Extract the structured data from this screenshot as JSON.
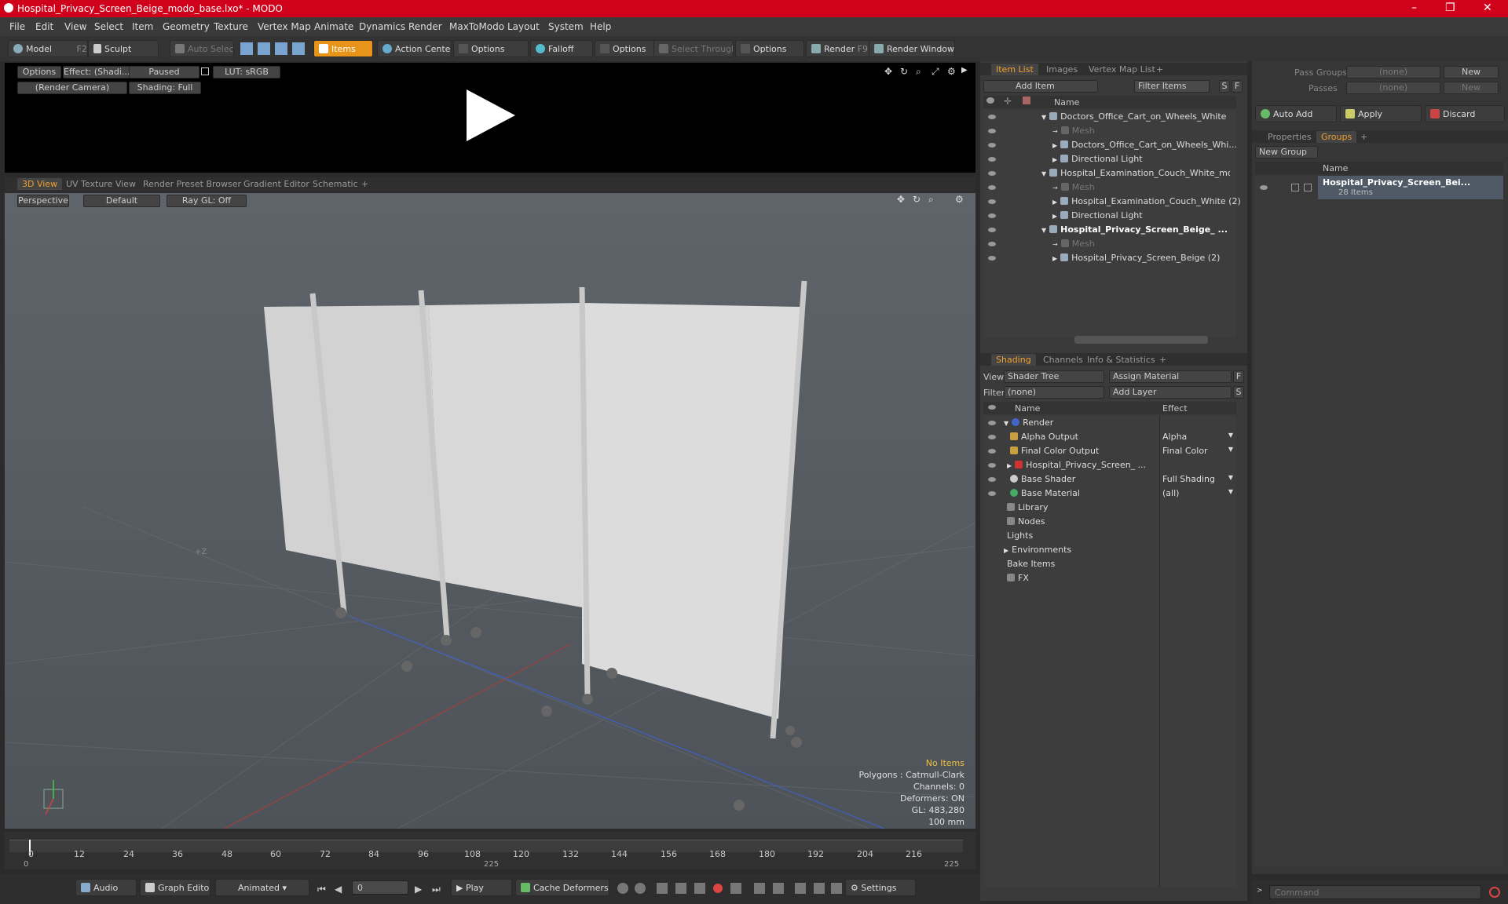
{
  "window": {
    "title": "Hospital_Privacy_Screen_Beige_modo_base.lxo* - MODO",
    "minimize": "–",
    "maximize": "❐",
    "close": "✕"
  },
  "menu": [
    "File",
    "Edit",
    "View",
    "Select",
    "Item",
    "Geometry",
    "Texture",
    "Vertex Map",
    "Animate",
    "Dynamics",
    "Render",
    "MaxToModo",
    "Layout",
    "System",
    "Help"
  ],
  "toolbar": {
    "model": "Model",
    "model_key": "F2",
    "sculpt": "Sculpt",
    "auto_select": "Auto Select",
    "items": "Items",
    "action_center": "Action Center",
    "options1": "Options",
    "falloff": "Falloff",
    "options2": "Options",
    "select_through": "Select Through",
    "options3": "Options",
    "render": "Render",
    "render_key": "F9",
    "render_window": "Render Window"
  },
  "preview": {
    "options": "Options",
    "effect": "Effect: (Shadi...",
    "paused": "Paused",
    "lut": "LUT: sRGB",
    "camera": "(Render Camera)",
    "shading": "Shading: Full"
  },
  "viewport_tabs": [
    "3D View",
    "UV Texture View",
    "Render Preset Browser",
    "Gradient Editor",
    "Schematic",
    "+"
  ],
  "viewport": {
    "perspective": "Perspective",
    "default": "Default",
    "raygl": "Ray GL: Off",
    "axis_label": "+Z",
    "hud": [
      "No Items",
      "Polygons : Catmull-Clark",
      "Channels: 0",
      "Deformers: ON",
      "GL: 483,280",
      "100 mm"
    ]
  },
  "timeline": {
    "ticks": [
      "0",
      "12",
      "24",
      "36",
      "48",
      "60",
      "72",
      "84",
      "96",
      "108",
      "120",
      "132",
      "144",
      "156",
      "168",
      "180",
      "192",
      "204",
      "216"
    ],
    "start": "0",
    "mid": "225",
    "end": "225"
  },
  "bottom": {
    "audio": "Audio",
    "graph_editor": "Graph Editor",
    "animated": "Animated",
    "frame": "0",
    "play": "Play",
    "cache": "Cache Deformers",
    "settings": "Settings"
  },
  "item_list": {
    "tabs": [
      "Item List",
      "Images",
      "Vertex Map List",
      "+"
    ],
    "add_item": "Add Item",
    "filter": "Filter Items",
    "s": "S",
    "f": "F",
    "col_name": "Name",
    "rows": [
      {
        "label": "Doctors_Office_Cart_on_Wheels_White ...",
        "indent": 0,
        "bold": false,
        "dim": false
      },
      {
        "label": "Mesh",
        "indent": 1,
        "bold": false,
        "dim": true
      },
      {
        "label": "Doctors_Office_Cart_on_Wheels_Whi...",
        "indent": 1,
        "bold": false,
        "dim": false
      },
      {
        "label": "Directional Light",
        "indent": 1,
        "bold": false,
        "dim": false
      },
      {
        "label": "Hospital_Examination_Couch_White_mo ...",
        "indent": 0,
        "bold": false,
        "dim": false
      },
      {
        "label": "Mesh",
        "indent": 1,
        "bold": false,
        "dim": true
      },
      {
        "label": "Hospital_Examination_Couch_White (2)",
        "indent": 1,
        "bold": false,
        "dim": false
      },
      {
        "label": "Directional Light",
        "indent": 1,
        "bold": false,
        "dim": false
      },
      {
        "label": "Hospital_Privacy_Screen_Beige_ ...",
        "indent": 0,
        "bold": true,
        "dim": false
      },
      {
        "label": "Mesh",
        "indent": 1,
        "bold": false,
        "dim": true
      },
      {
        "label": "Hospital_Privacy_Screen_Beige (2)",
        "indent": 1,
        "bold": false,
        "dim": false
      }
    ]
  },
  "shading": {
    "tabs": [
      "Shading",
      "Channels",
      "Info & Statistics",
      "+"
    ],
    "view_label": "View",
    "view_value": "Shader Tree",
    "assign": "Assign Material",
    "filter_label": "Filter",
    "filter_value": "(none)",
    "add_layer": "Add Layer",
    "f": "F",
    "s": "S",
    "col_name": "Name",
    "col_effect": "Effect",
    "rows": [
      {
        "label": "Render",
        "effect": "",
        "indent": 0,
        "color": "#4466cc"
      },
      {
        "label": "Alpha Output",
        "effect": "Alpha",
        "indent": 1,
        "color": "#c9a040"
      },
      {
        "label": "Final Color Output",
        "effect": "Final Color",
        "indent": 1,
        "color": "#c9a040"
      },
      {
        "label": "Hospital_Privacy_Screen_ ...",
        "effect": "",
        "indent": 1,
        "color": "#cc3333"
      },
      {
        "label": "Base Shader",
        "effect": "Full Shading",
        "indent": 1,
        "color": "#cccccc"
      },
      {
        "label": "Base Material",
        "effect": "(all)",
        "indent": 1,
        "color": "#44aa66"
      },
      {
        "label": "Library",
        "effect": "",
        "indent": 0,
        "color": "#888888"
      },
      {
        "label": "Nodes",
        "effect": "",
        "indent": 0,
        "color": "#888888"
      },
      {
        "label": "Lights",
        "effect": "",
        "indent": 0,
        "color": ""
      },
      {
        "label": "Environments",
        "effect": "",
        "indent": 0,
        "color": ""
      },
      {
        "label": "Bake Items",
        "effect": "",
        "indent": 0,
        "color": ""
      },
      {
        "label": "FX",
        "effect": "",
        "indent": 0,
        "color": "#888888"
      }
    ]
  },
  "groups": {
    "pass_groups": "Pass Groups",
    "passes": "Passes",
    "none": "(none)",
    "new": "New",
    "auto_add": "Auto Add",
    "apply": "Apply",
    "discard": "Discard",
    "tabs": [
      "Properties",
      "Groups",
      "+"
    ],
    "new_group": "New Group",
    "col_name": "Name",
    "group_name": "Hospital_Privacy_Screen_Bei...",
    "group_count": "28 Items"
  },
  "command": {
    "placeholder": "Command"
  }
}
